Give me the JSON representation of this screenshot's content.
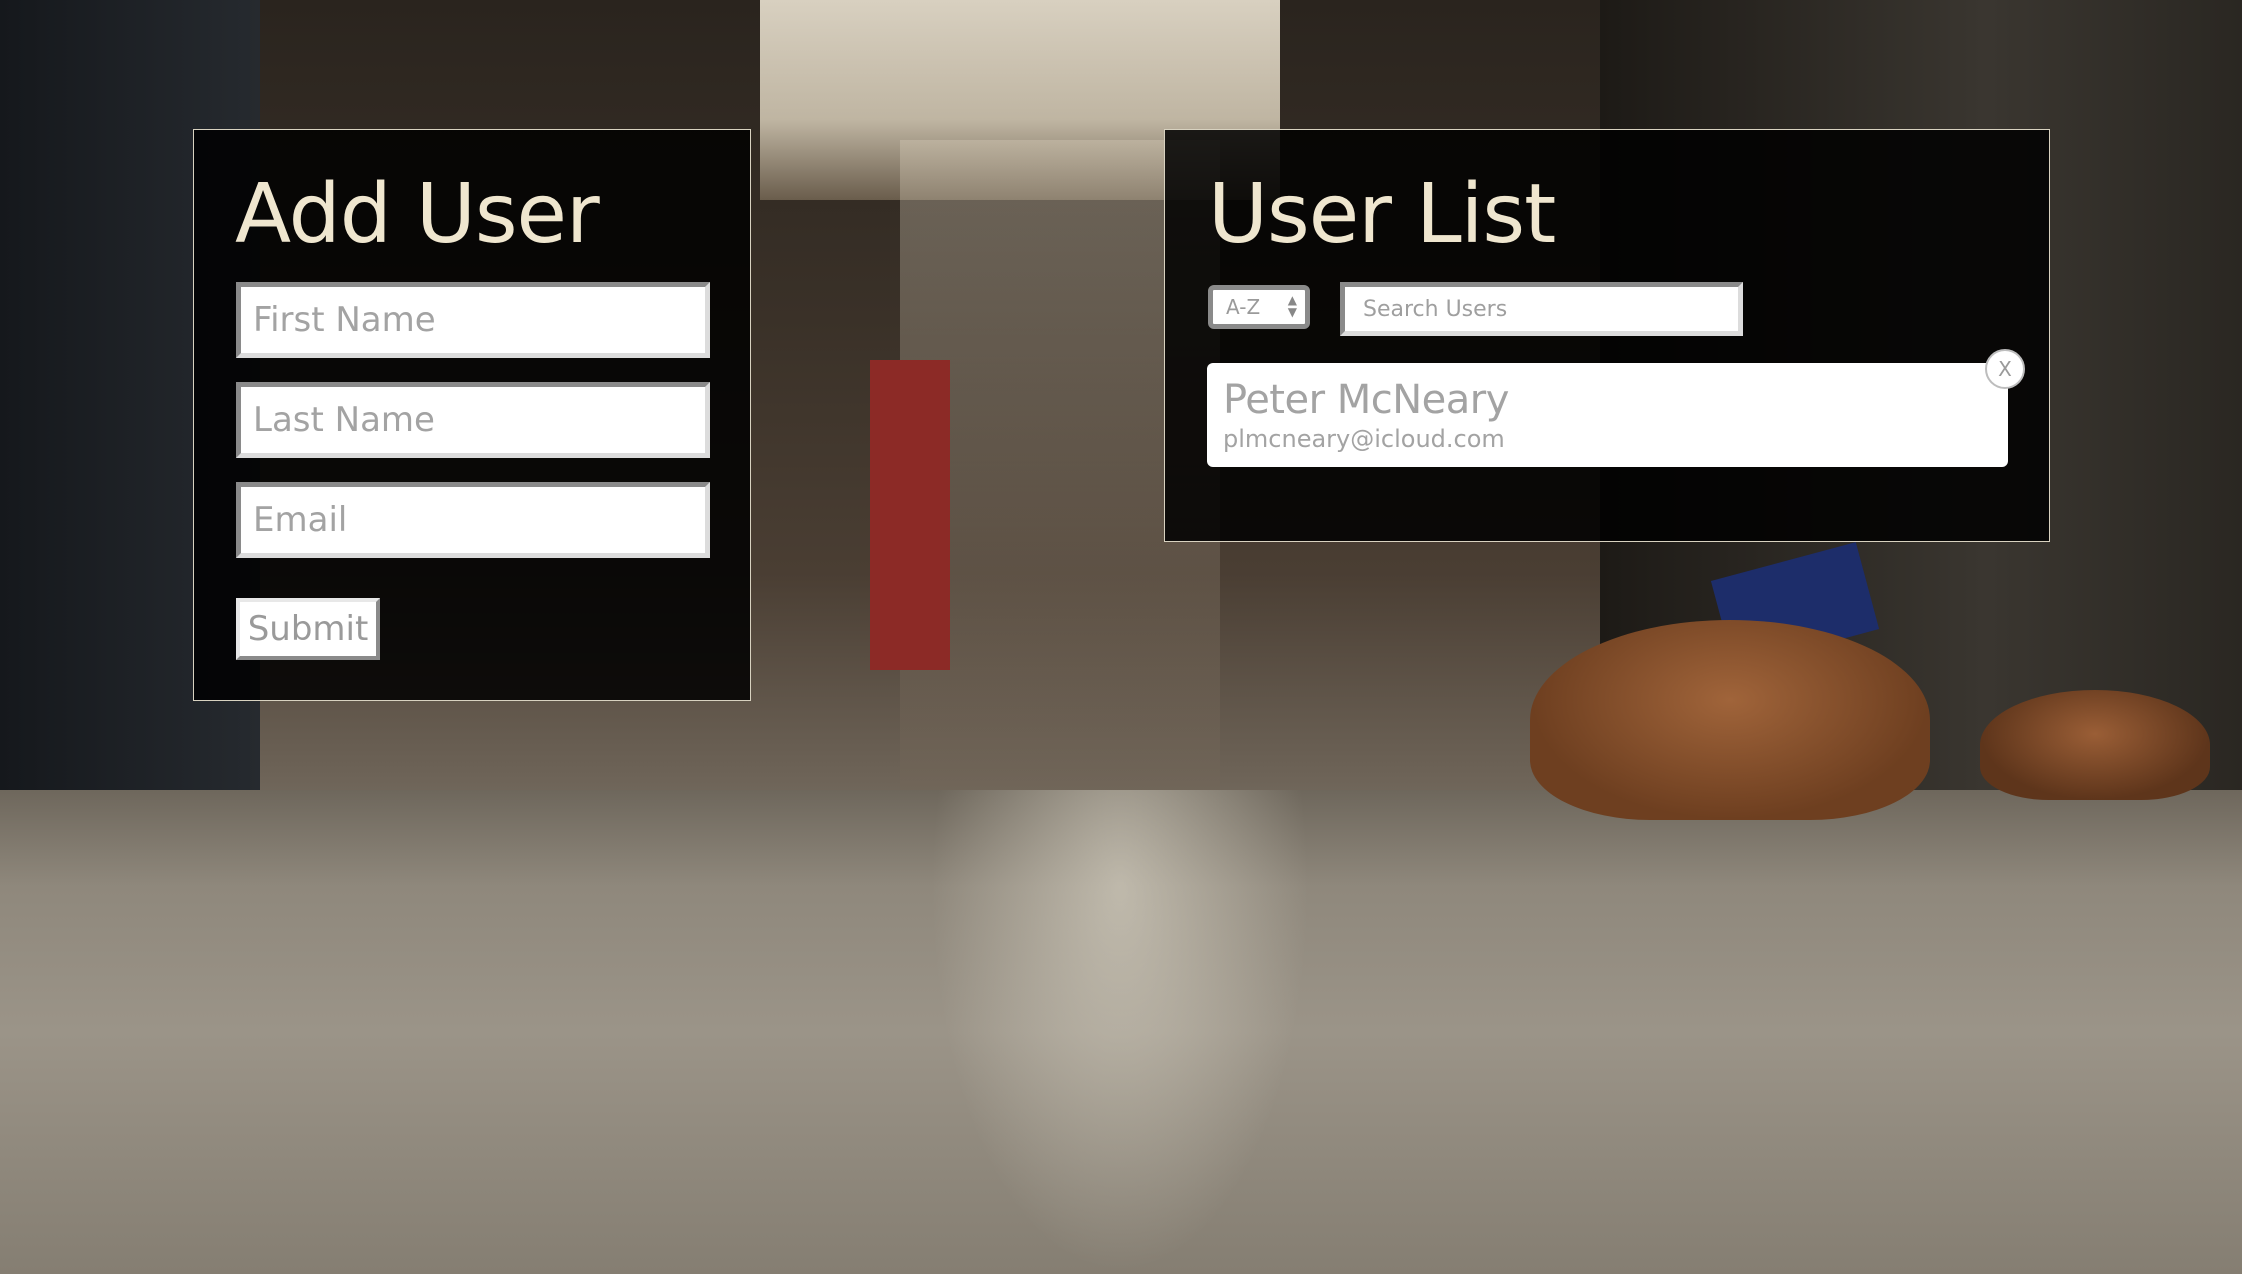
{
  "add_user": {
    "title": "Add User",
    "first_name_placeholder": "First Name",
    "last_name_placeholder": "Last Name",
    "email_placeholder": "Email",
    "submit_label": "Submit"
  },
  "user_list": {
    "title": "User List",
    "sort": {
      "selected": "A-Z",
      "arrows": "▲\n▼"
    },
    "search_placeholder": "Search Users",
    "users": [
      {
        "name": "Peter McNeary",
        "email": "plmcneary@icloud.com",
        "delete_label": "X"
      }
    ]
  },
  "colors": {
    "panel_bg": "#000000",
    "panel_border": "#d8d2c0",
    "title_color": "#efe6cf",
    "placeholder_color": "#a3a3a3"
  }
}
